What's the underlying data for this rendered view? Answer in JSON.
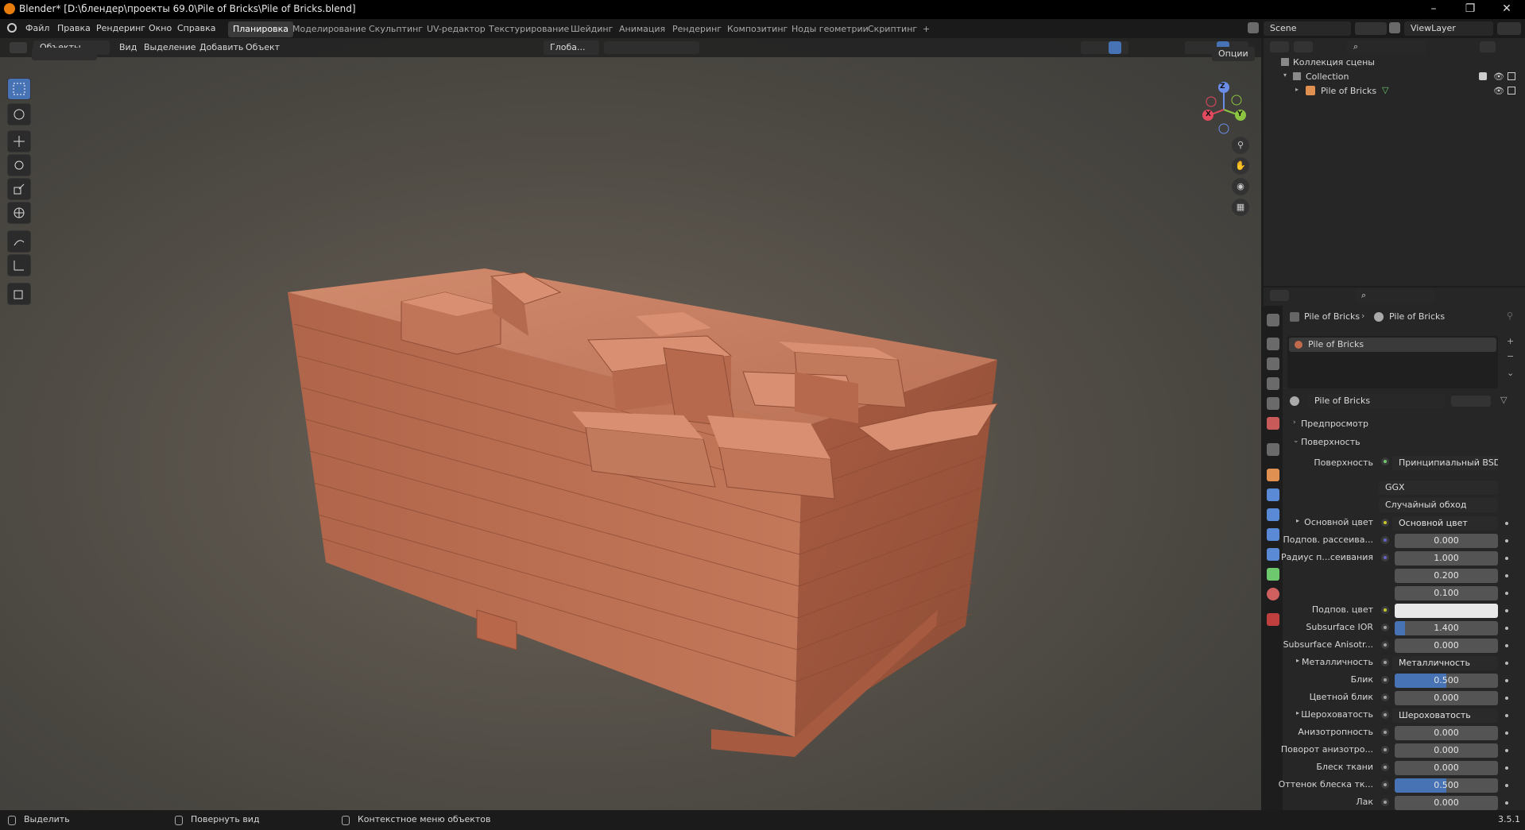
{
  "window": {
    "title": "Blender* [D:\\блендер\\проекты 69.0\\Pile of Bricks\\Pile of Bricks.blend]",
    "controls": [
      "–",
      "❐",
      "✕"
    ]
  },
  "menu": [
    "Файл",
    "Правка",
    "Рендеринг",
    "Окно",
    "Справка"
  ],
  "workspaces": [
    "Планировка",
    "Моделирование",
    "Скульптинг",
    "UV-редактор",
    "Текстурирование",
    "Шейдинг",
    "Анимация",
    "Рендеринг",
    "Композитинг",
    "Ноды геометрии",
    "Скриптинг",
    "+"
  ],
  "scene": {
    "name": "Scene",
    "view_layer": "ViewLayer"
  },
  "viewport": {
    "mode": "Объекты",
    "menus": [
      "Вид",
      "Выделение",
      "Добавить",
      "Объект"
    ],
    "orientation": "Глоба...",
    "options": "Опции",
    "gizmo": {
      "x": "X",
      "y": "Y",
      "z": "Z"
    }
  },
  "outliner": {
    "root": "Коллекция сцены",
    "collection": "Collection",
    "object": "Pile of Bricks"
  },
  "properties": {
    "breadcrumb_object": "Pile of Bricks",
    "breadcrumb_material": "Pile of Bricks",
    "material_slot": "Pile of Bricks",
    "material_name": "Pile of Bricks",
    "panel_preview": "Предпросмотр",
    "panel_surface": "Поверхность",
    "surface_label": "Поверхность",
    "surface_value": "Принципиальный BSDF",
    "distribution": "GGX",
    "subsurface_method": "Случайный обход",
    "rows": [
      {
        "label": "Основной цвет",
        "value": "Основной цвет",
        "kind": "link",
        "expand": true,
        "socket": "#c7c729"
      },
      {
        "label": "Подпов. рассеива...",
        "value": "0.000",
        "kind": "num",
        "socket": "#6363c7"
      },
      {
        "label": "Радиус п...сеивания",
        "value": "1.000",
        "kind": "num",
        "socket": "#6363c7"
      },
      {
        "label": "",
        "value": "0.200",
        "kind": "num",
        "socket": ""
      },
      {
        "label": "",
        "value": "0.100",
        "kind": "num",
        "socket": ""
      },
      {
        "label": "Подпов. цвет",
        "value": "",
        "kind": "color",
        "socket": "#c7c729"
      },
      {
        "label": "Subsurface IOR",
        "value": "1.400",
        "kind": "num",
        "socket": "#a1a1a1",
        "fill": 0.1
      },
      {
        "label": "Subsurface Anisotr...",
        "value": "0.000",
        "kind": "num",
        "socket": "#a1a1a1"
      },
      {
        "label": "Металличность",
        "value": "Металличность",
        "kind": "link",
        "expand": true,
        "socket": "#a1a1a1"
      },
      {
        "label": "Блик",
        "value": "0.500",
        "kind": "num",
        "socket": "#a1a1a1",
        "fill": 0.5
      },
      {
        "label": "Цветной блик",
        "value": "0.000",
        "kind": "num",
        "socket": "#a1a1a1"
      },
      {
        "label": "Шероховатость",
        "value": "Шероховатость",
        "kind": "link",
        "expand": true,
        "socket": "#a1a1a1"
      },
      {
        "label": "Анизотропность",
        "value": "0.000",
        "kind": "num",
        "socket": "#a1a1a1"
      },
      {
        "label": "Поворот анизотро...",
        "value": "0.000",
        "kind": "num",
        "socket": "#a1a1a1"
      },
      {
        "label": "Блеск ткани",
        "value": "0.000",
        "kind": "num",
        "socket": "#a1a1a1"
      },
      {
        "label": "Оттенок блеска тк...",
        "value": "0.500",
        "kind": "num",
        "socket": "#a1a1a1",
        "fill": 0.5
      },
      {
        "label": "Лак",
        "value": "0.000",
        "kind": "num",
        "socket": "#a1a1a1"
      }
    ]
  },
  "statusbar": {
    "select": "Выделить",
    "rotate": "Повернуть вид",
    "context": "Контекстное меню объектов",
    "version": "3.5.1"
  },
  "colors": {
    "accent": "#4772b3",
    "brick": "#b8674a",
    "header": "#1a1a1a"
  }
}
